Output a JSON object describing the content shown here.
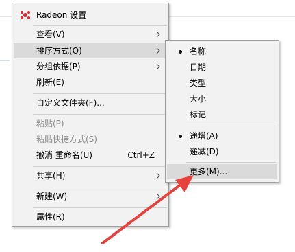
{
  "main_menu": {
    "header": {
      "label": "Radeon 设置",
      "icon": "radeon-icon"
    },
    "items": [
      {
        "label": "查看(V)",
        "submenu": true
      },
      {
        "label": "排序方式(O)",
        "submenu": true,
        "highlighted": true
      },
      {
        "label": "分组依据(P)",
        "submenu": true
      },
      {
        "label": "刷新(E)"
      },
      {
        "label": "自定义文件夹(F)..."
      },
      {
        "label": "粘贴(P)",
        "disabled": true
      },
      {
        "label": "粘贴快捷方式(S)",
        "disabled": true
      },
      {
        "label": "撤消 重命名(U)",
        "shortcut": "Ctrl+Z"
      },
      {
        "label": "共享(H)",
        "submenu": true
      },
      {
        "label": "新建(W)",
        "submenu": true
      },
      {
        "label": "属性(R)"
      }
    ]
  },
  "sort_submenu": {
    "items": [
      {
        "label": "名称",
        "selected": true
      },
      {
        "label": "日期"
      },
      {
        "label": "类型"
      },
      {
        "label": "大小"
      },
      {
        "label": "标记"
      },
      {
        "label": "递增(A)",
        "selected": true
      },
      {
        "label": "递减(D)"
      },
      {
        "label": "更多(M)...",
        "highlighted": true
      }
    ]
  },
  "colors": {
    "menu_bg": "#f2f2f2",
    "highlight": "#dadada",
    "annotation_arrow": "#e8423c",
    "radeon_red": "#e0262b"
  }
}
